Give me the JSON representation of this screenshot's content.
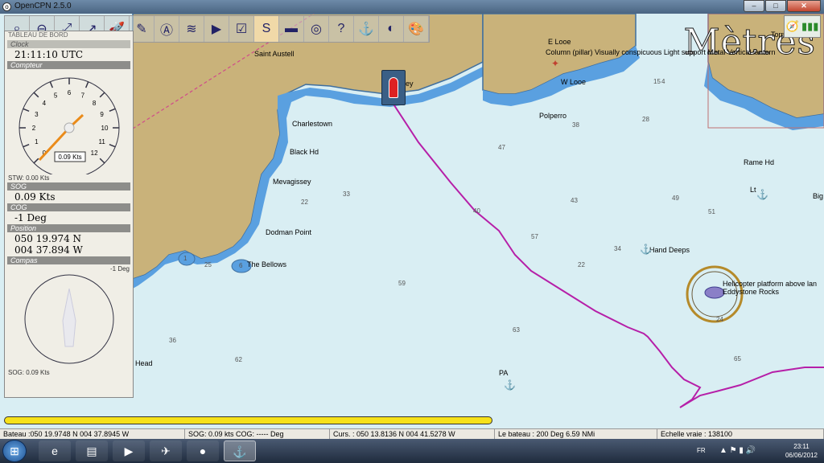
{
  "window": {
    "title": "OpenCPN 2.5.0",
    "minimize": "–",
    "maximize": "□",
    "close": "✕"
  },
  "toolbar": {
    "items": [
      "zoom-in-icon",
      "zoom-out-icon",
      "scale-icon",
      "route-icon",
      "rocket-icon",
      "measure-icon",
      "ais-icon",
      "layers-icon",
      "track-icon",
      "settings-icon",
      "route-manager-icon",
      "tide-icon",
      "anchor-icon",
      "help-icon",
      "ship-icon",
      "globe-icon",
      "color-icon"
    ],
    "active_index": 10
  },
  "dashboard": {
    "title": "TABLEAU DE BORD",
    "sections": {
      "clock": {
        "label": "Clock",
        "value": "21:11:10 UTC"
      },
      "speed": {
        "label": "Compteur",
        "readout": "0.09 Kts",
        "stw": "STW: 0.00 Kts",
        "ticks": [
          "0",
          "1",
          "2",
          "3",
          "4",
          "5",
          "6",
          "7",
          "8",
          "9",
          "10",
          "11",
          "12"
        ]
      },
      "sog": {
        "label": "SOG",
        "value": "0.09 Kts"
      },
      "cog": {
        "label": "COG",
        "value": "-1 Deg"
      },
      "position": {
        "label": "Position",
        "lat": "050 19.974 N",
        "lon": "004 37.894 W"
      },
      "compass": {
        "label": "Compas",
        "heading": "-1 Deg",
        "sog": "SOG: 0.09 Kts"
      }
    }
  },
  "chart": {
    "units": "Mètres",
    "places": [
      {
        "name": "Saint Austell"
      },
      {
        "name": "Charlestown"
      },
      {
        "name": "Black Hd"
      },
      {
        "name": "Mevagissey"
      },
      {
        "name": "Dodman Point"
      },
      {
        "name": "The Bellows"
      },
      {
        "name": "Polperro"
      },
      {
        "name": "E Looe"
      },
      {
        "name": "W Looe"
      },
      {
        "name": "Rame Hd"
      },
      {
        "name": "Hand Deeps"
      },
      {
        "name": "Eddystone Rocks"
      },
      {
        "name": "Helicopter platform above lan"
      },
      {
        "name": "Column (pillar) Visually conspicuous Light support Metal Vertical lantern"
      },
      {
        "name": "Head"
      },
      {
        "name": "PA"
      },
      {
        "name": "Lt"
      },
      {
        "name": "Big"
      },
      {
        "name": "Torpoint"
      },
      {
        "name": "ey"
      }
    ],
    "depths": [
      "15",
      "4",
      "28",
      "38",
      "47",
      "43",
      "49",
      "51",
      "33",
      "22",
      "57",
      "34",
      "22",
      "59",
      "25",
      "1",
      "6",
      "63",
      "62",
      "36",
      "65",
      "24",
      "40"
    ]
  },
  "status": {
    "boat": "Bateau :050 19.9748 N    004 37.8945 W",
    "sog": "SOG: 0.09 kts  COG: ----- Deg",
    "cursor": "Curs. : 050 13.8136 N 004 41.5278 W",
    "bearing": "Le bateau : 200 Deg    6.59 NMi",
    "scale": "Echelle vraie :   138100"
  },
  "taskbar": {
    "lang": "FR",
    "time": "23:11",
    "date": "06/06/2012"
  }
}
